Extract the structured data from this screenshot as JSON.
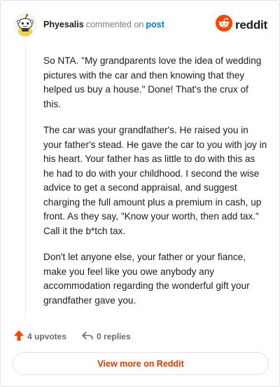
{
  "header": {
    "username": "Phyesalis",
    "commented_on": "commented on",
    "post_link": "post",
    "brand": "reddit"
  },
  "comment": {
    "paragraphs": [
      "So NTA. \"My grandparents love the idea of wedding pictures with the car and then knowing that they helped us buy a house.\" Done! That's the crux of this.",
      "The car was your grandfather's. He raised you in your father's stead. He gave the car to you with joy in his heart. Your father has as little to do with this as he had to do with your childhood. I second the wise advice to get a second appraisal, and suggest charging the full amount plus a premium in cash, up front. As they say, \"Know your worth, then add tax.\" Call it the b*tch tax.",
      "Don't let anyone else, your father or your fiance, make you feel like you owe anybody any accommodation regarding the wonderful gift your grandfather gave you."
    ]
  },
  "actions": {
    "upvotes": "4 upvotes",
    "replies": "0 replies"
  },
  "footer": {
    "view_more": "View more on Reddit"
  },
  "colors": {
    "accent": "#ff4500",
    "link": "#0079d3",
    "cta": "#d93a00",
    "muted": "#7c7c7c"
  },
  "icons": {
    "avatar": "snoo-avatar-icon",
    "brand": "reddit-logo-icon",
    "upvote": "upvote-arrow-icon",
    "reply": "reply-arrow-icon"
  }
}
